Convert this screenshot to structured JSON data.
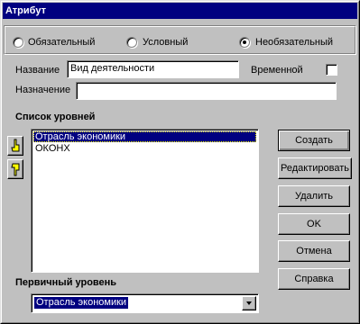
{
  "window": {
    "title": "Атрибут"
  },
  "mode": {
    "options": [
      {
        "label": "Обязательный",
        "selected": false
      },
      {
        "label": "Условный",
        "selected": false
      },
      {
        "label": "Необязательный",
        "selected": true
      }
    ]
  },
  "form": {
    "name_label": "Название",
    "name_value": "Вид деятельности",
    "temporary_label": "Временной",
    "temporary_checked": false,
    "purpose_label": "Назначение",
    "purpose_value": ""
  },
  "levels": {
    "heading": "Список уровней",
    "items": [
      {
        "label": "Отрасль экономики",
        "selected": true
      },
      {
        "label": "ОКОНХ",
        "selected": false
      }
    ]
  },
  "buttons": {
    "create": "Создать",
    "edit": "Редактировать",
    "delete": "Удалить",
    "ok": "OK",
    "cancel": "Отмена",
    "help": "Справка"
  },
  "primary_level": {
    "heading": "Первичный уровень",
    "value": "Отрасль экономики"
  },
  "icons": {
    "move_up": "pointing-hand-up-icon",
    "move_down": "pointing-hand-down-icon",
    "dropdown": "chevron-down-icon"
  }
}
